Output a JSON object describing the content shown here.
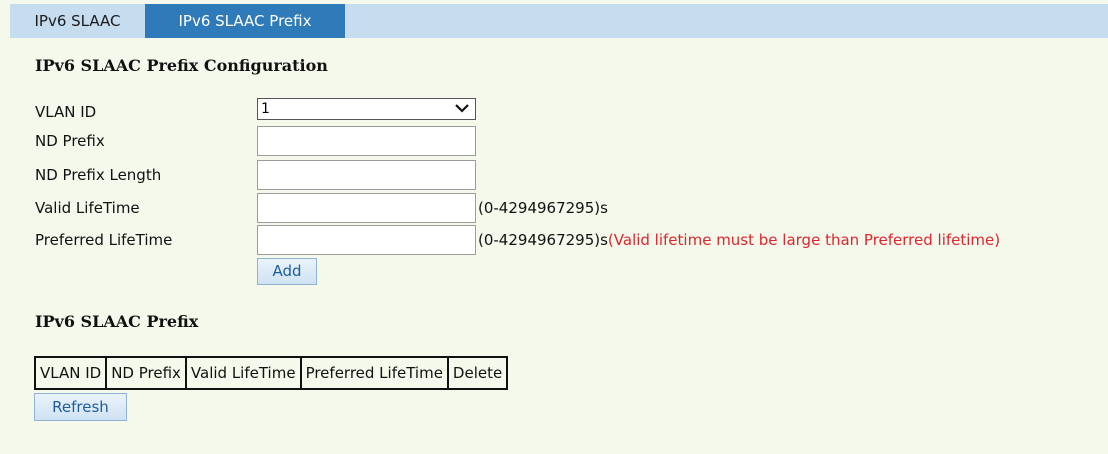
{
  "tabs": [
    {
      "label": "IPv6 SLAAC",
      "active": false
    },
    {
      "label": "IPv6 SLAAC Prefix",
      "active": true
    }
  ],
  "config": {
    "heading": "IPv6 SLAAC Prefix Configuration",
    "vlan_id_label": "VLAN ID",
    "vlan_id_value": "1",
    "nd_prefix_label": "ND Prefix",
    "nd_prefix_value": "",
    "nd_prefix_length_label": "ND Prefix Length",
    "nd_prefix_length_value": "",
    "valid_lifetime_label": "Valid LifeTime",
    "valid_lifetime_value": "",
    "valid_lifetime_hint": "(0-4294967295)s",
    "preferred_lifetime_label": "Preferred LifeTime",
    "preferred_lifetime_value": "",
    "preferred_lifetime_hint": "(0-4294967295)s",
    "preferred_lifetime_warning": "(Valid lifetime must be large than Preferred lifetime)",
    "add_label": "Add"
  },
  "prefix_table": {
    "heading": "IPv6 SLAAC Prefix",
    "columns": [
      "VLAN ID",
      "ND Prefix",
      "Valid LifeTime",
      "Preferred LifeTime",
      "Delete"
    ],
    "rows": [],
    "refresh_label": "Refresh"
  },
  "colors": {
    "page_bg": "#f4f9ec",
    "tabbar_bg": "#c6ddf0",
    "active_tab_bg": "#2f7ab8",
    "warning": "#e0252c"
  }
}
